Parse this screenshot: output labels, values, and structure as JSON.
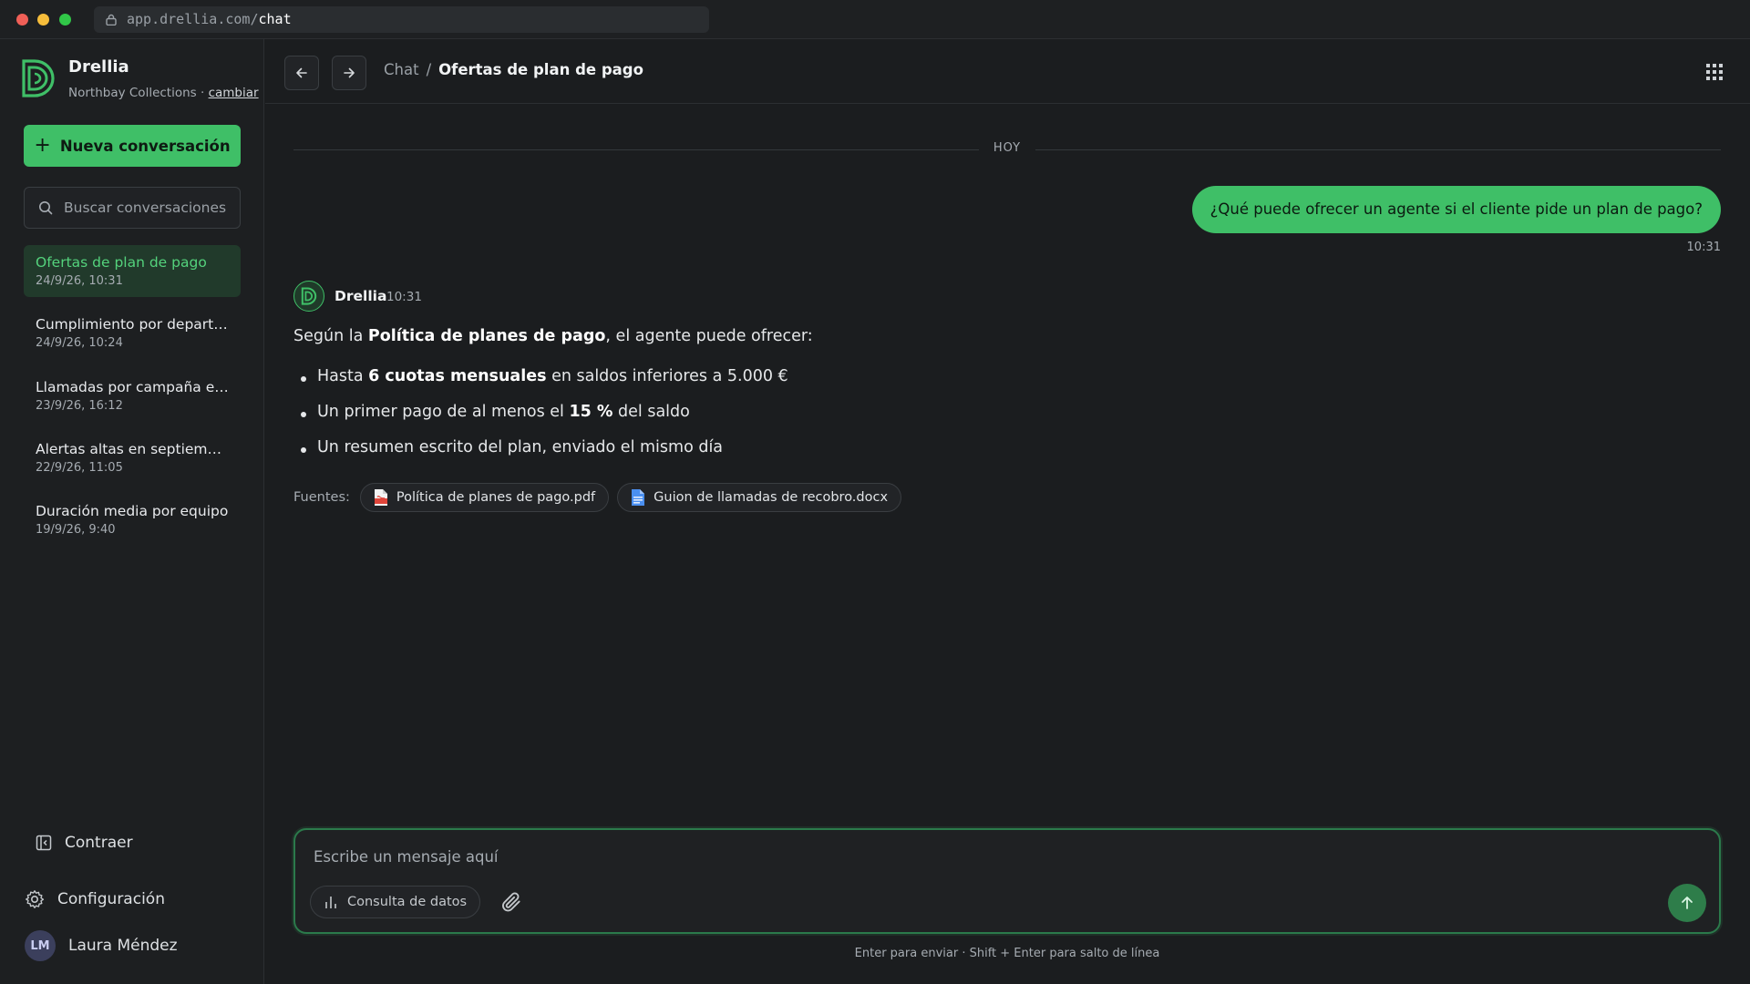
{
  "browser": {
    "url_host": "app.drellia.com/",
    "url_path": "chat"
  },
  "sidebar": {
    "brand_name": "Drellia",
    "workspace": "Northbay Collections",
    "workspace_sep": " · ",
    "change_label": "cambiar",
    "new_chat_label": "Nueva conversación",
    "search_placeholder": "Buscar conversaciones",
    "conversations": [
      {
        "title": "Ofertas de plan de pago",
        "date": "24/9/26, 10:31",
        "active": true
      },
      {
        "title": "Cumplimiento por departa...",
        "date": "24/9/26, 10:24"
      },
      {
        "title": "Llamadas por campaña est...",
        "date": "23/9/26, 16:12"
      },
      {
        "title": "Alertas altas en septiembre",
        "date": "22/9/26, 11:05"
      },
      {
        "title": "Duración media por equipo",
        "date": "19/9/26, 9:40"
      }
    ],
    "collapse_label": "Contraer",
    "settings_label": "Configuración",
    "user_initials": "LM",
    "user_name": "Laura Méndez"
  },
  "header": {
    "crumb_root": "Chat",
    "crumb_sep": "/",
    "crumb_current": "Ofertas de plan de pago"
  },
  "chat": {
    "day_label": "HOY",
    "user_message": "¿Qué puede ofrecer un agente si el cliente pide un plan de pago?",
    "user_time": "10:31",
    "bot_name": "Drellia",
    "bot_time": "10:31",
    "intro_pre": "Según la ",
    "intro_bold": "Política de planes de pago",
    "intro_post": ", el agente puede ofrecer:",
    "bullets": [
      {
        "pre": "Hasta ",
        "bold": "6 cuotas mensuales",
        "post": " en saldos inferiores a 5.000 €"
      },
      {
        "pre": "Un primer pago de al menos el ",
        "bold": "15 %",
        "post": " del saldo"
      },
      {
        "pre": "Un resumen escrito del plan, enviado el mismo día",
        "bold": "",
        "post": ""
      }
    ],
    "sources_label": "Fuentes:",
    "sources": [
      {
        "name": "Política de planes de pago.pdf",
        "icon": "pdf-file-icon"
      },
      {
        "name": "Guion de llamadas de recobro.docx",
        "icon": "docx-file-icon"
      }
    ]
  },
  "composer": {
    "placeholder": "Escribe un mensaje aquí",
    "data_query_label": "Consulta de datos",
    "hint": "Enter para enviar · Shift + Enter para salto de línea"
  },
  "colors": {
    "accent": "#3fbf67",
    "background": "#1b1d1f",
    "active_item": "#213a2b"
  }
}
